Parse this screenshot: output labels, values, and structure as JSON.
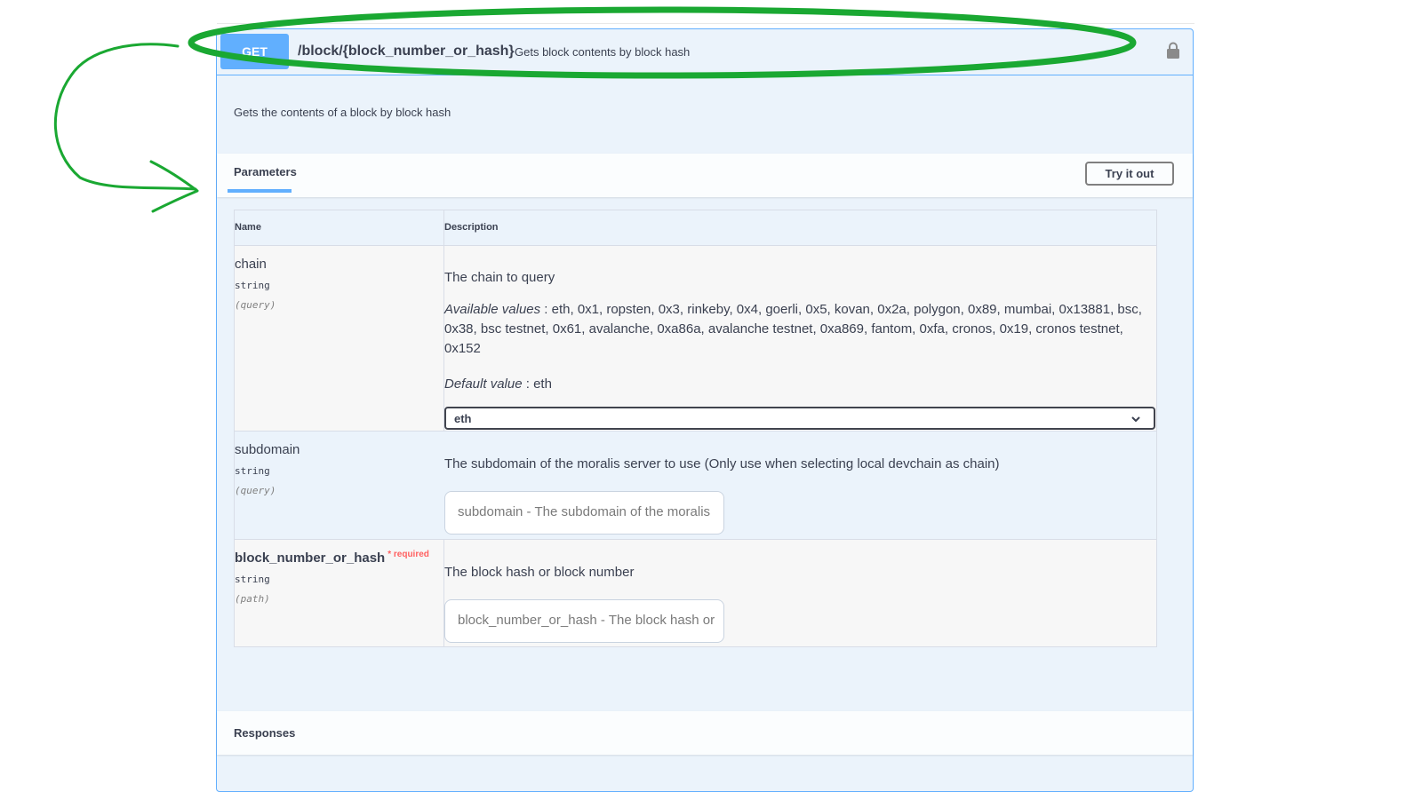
{
  "summary": {
    "method": "GET",
    "path": "/block/{block_number_or_hash}",
    "description": "Gets block contents by block hash"
  },
  "description": "Gets the contents of a block by block hash",
  "tabs": {
    "parameters": "Parameters",
    "try_it_out": "Try it out"
  },
  "table": {
    "col_name": "Name",
    "col_description": "Description"
  },
  "params": [
    {
      "name": "chain",
      "type": "string",
      "in": "(query)",
      "description": "The chain to query",
      "available_label": "Available values",
      "available_values": " : eth, 0x1, ropsten, 0x3, rinkeby, 0x4, goerli, 0x5, kovan, 0x2a, polygon, 0x89, mumbai, 0x13881, bsc, 0x38, bsc testnet, 0x61, avalanche, 0xa86a, avalanche testnet, 0xa869, fantom, 0xfa, cronos, 0x19, cronos testnet, 0x152",
      "default_label": "Default value",
      "default_value": " : eth",
      "selected": "eth"
    },
    {
      "name": "subdomain",
      "type": "string",
      "in": "(query)",
      "description": "The subdomain of the moralis server to use (Only use when selecting local devchain as chain)",
      "placeholder": "subdomain - The subdomain of the moralis"
    },
    {
      "name": "block_number_or_hash",
      "required_mark": "* required",
      "type": "string",
      "in": "(path)",
      "description": "The block hash or block number",
      "placeholder": "block_number_or_hash - The block hash or"
    }
  ],
  "responses": "Responses",
  "colors": {
    "get_blue": "#61affe",
    "panel_bg": "#ebf3fb",
    "annotation_green": "#1aa832",
    "required_red": "#ff6060"
  },
  "icons": {
    "lock": "lock-icon",
    "chevron": "chevron-down-icon"
  }
}
